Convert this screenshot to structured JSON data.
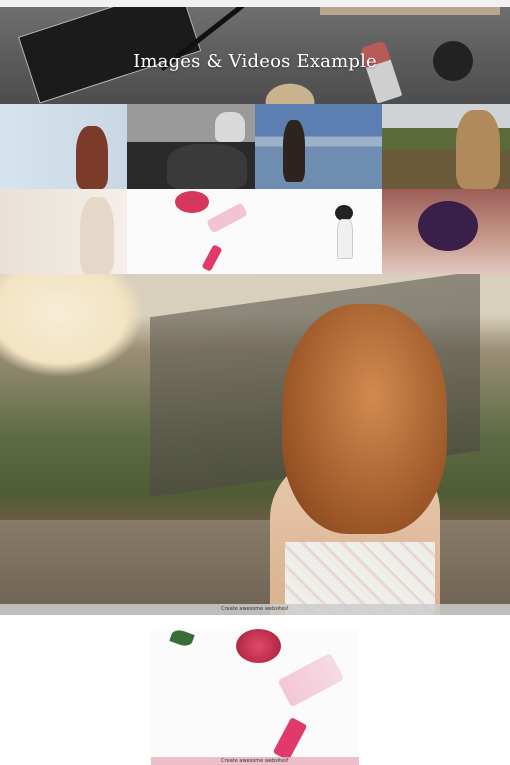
{
  "hero": {
    "title": "Images & Videos Example"
  },
  "gallery": {
    "tiles": [
      {
        "name": "woman-white-curtains"
      },
      {
        "name": "woman-sitting-sofa"
      },
      {
        "name": "woman-lake-view"
      },
      {
        "name": "woman-river-landscape"
      },
      {
        "name": "bride-window"
      },
      {
        "name": "flowers-perfume-flatlay"
      },
      {
        "name": "woman-white-dress"
      },
      {
        "name": "woman-purple-hair"
      }
    ]
  },
  "featured": {
    "caption": "Create awesome websites!"
  },
  "single": {
    "caption": "Create awesome websites!"
  }
}
